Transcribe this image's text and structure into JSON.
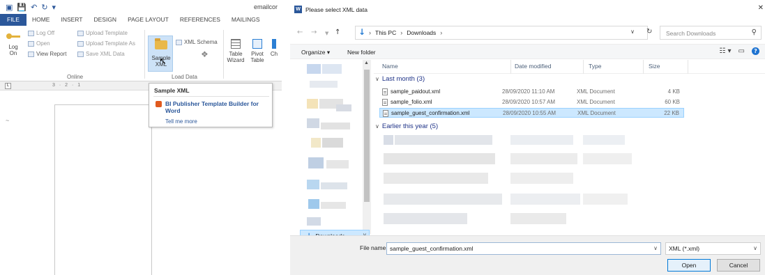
{
  "word": {
    "doc_title": "emailcor",
    "tabs": [
      "FILE",
      "HOME",
      "INSERT",
      "DESIGN",
      "PAGE LAYOUT",
      "REFERENCES",
      "MAILINGS"
    ],
    "ribbon": {
      "log_on": "Log On",
      "log_off": "Log Off",
      "open": "Open",
      "view_report": "View Report",
      "upload_template": "Upload Template",
      "upload_template_as": "Upload Template As",
      "save_xml_data": "Save XML Data",
      "group_online": "Online",
      "sample_xml": "Sample XML",
      "xml_schema": "XML Schema",
      "group_load_data": "Load Data",
      "table_wizard": "Table Wizard",
      "pivot_table": "Pivot Table",
      "chart": "Ch"
    },
    "ruler_text": "3 · 2 · 1",
    "tooltip": {
      "title": "Sample XML",
      "body": "BI Publisher Template Builder for Word",
      "more": "Tell me more"
    }
  },
  "dialog": {
    "title": "Please select XML data",
    "path": [
      "This PC",
      "Downloads"
    ],
    "search_placeholder": "Search Downloads",
    "organize": "Organize",
    "new_folder": "New folder",
    "columns": [
      "Name",
      "Date modified",
      "Type",
      "Size"
    ],
    "groups": [
      {
        "label": "Last month (3)",
        "files": [
          {
            "name": "sample_paidout.xml",
            "date": "28/09/2020 11:10 AM",
            "type": "XML Document",
            "size": "4 KB",
            "selected": false
          },
          {
            "name": "sample_folio.xml",
            "date": "28/09/2020 10:57 AM",
            "type": "XML Document",
            "size": "60 KB",
            "selected": false
          },
          {
            "name": "sample_guest_confirmation.xml",
            "date": "28/09/2020 10:55 AM",
            "type": "XML Document",
            "size": "22 KB",
            "selected": true
          }
        ]
      },
      {
        "label": "Earlier this year (5)",
        "files": []
      }
    ],
    "nav_selected": "Downloads",
    "file_name_label": "File name:",
    "file_name_value": "sample_guest_confirmation.xml",
    "file_type": "XML (*.xml)",
    "open_button": "Open",
    "cancel_button": "Cancel"
  }
}
